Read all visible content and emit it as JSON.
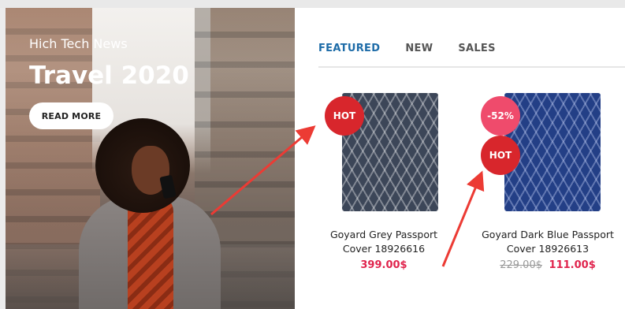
{
  "banner": {
    "subtitle": "Hich Tech News",
    "title": "Travel 2020",
    "button_label": "READ MORE"
  },
  "tabs": [
    {
      "label": "FEATURED",
      "active": true
    },
    {
      "label": "NEW",
      "active": false
    },
    {
      "label": "SALES",
      "active": false
    }
  ],
  "products": [
    {
      "name": "Goyard Grey Passport Cover 18926616",
      "price": "399.00$",
      "old_price": "",
      "badges": [
        {
          "type": "hot",
          "label": "HOT"
        }
      ]
    },
    {
      "name": "Goyard Dark Blue Passport Cover 18926613",
      "price": "111.00$",
      "old_price": "229.00$",
      "badges": [
        {
          "type": "sale",
          "label": "-52%"
        },
        {
          "type": "hot",
          "label": "HOT"
        }
      ]
    }
  ],
  "colors": {
    "accent_tab": "#1e6ca8",
    "price": "#e0244d",
    "hot_badge": "#d8262c",
    "sale_badge": "#ef4b6c",
    "annotation_arrow": "#ec3b34"
  }
}
